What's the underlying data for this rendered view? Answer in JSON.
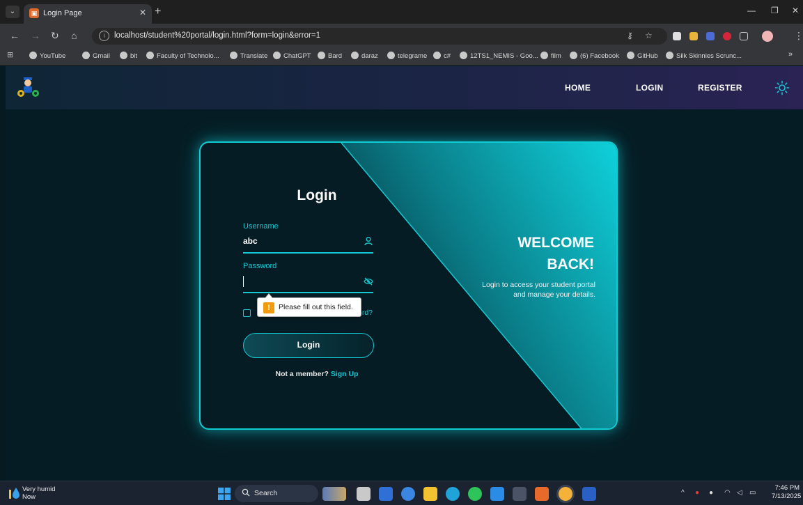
{
  "browser": {
    "tab_title": "Login Page",
    "url": "localhost/student%20portal/login.html?form=login&error=1",
    "bookmarks": [
      "YouTube",
      "Gmail",
      "bit",
      "Faculty of Technolo...",
      "Translate",
      "ChatGPT",
      "Bard",
      "daraz",
      "telegrame",
      "c#",
      "12TS1_NEMIS - Goo...",
      "film",
      "(6) Facebook",
      "GitHub",
      "Silk Skinnies Scrunc..."
    ],
    "bookmarks_more": "»"
  },
  "site_nav": {
    "links": [
      "HOME",
      "LOGIN",
      "REGISTER"
    ],
    "theme_icon": "sun-icon"
  },
  "login": {
    "title": "Login",
    "username_label": "Username",
    "username_value": "abc",
    "password_label": "Password",
    "password_value": "",
    "forgot_suffix": "ord?",
    "button": "Login",
    "not_member": "Not a member?",
    "signup": "Sign Up"
  },
  "welcome": {
    "line1": "WELCOME",
    "line2": "BACK!",
    "subtitle": "Login to access your student portal and manage your details."
  },
  "validation_tooltip": {
    "icon": "!",
    "text": "Please fill out this field."
  },
  "taskbar": {
    "weather": "Very humid",
    "weather_sub": "Now",
    "search": "Search",
    "time": "7:46 PM",
    "date": "7/13/2025"
  },
  "colors": {
    "accent": "#14c9d3",
    "background": "#061c24",
    "nav_gradient_end": "#2a2354"
  }
}
